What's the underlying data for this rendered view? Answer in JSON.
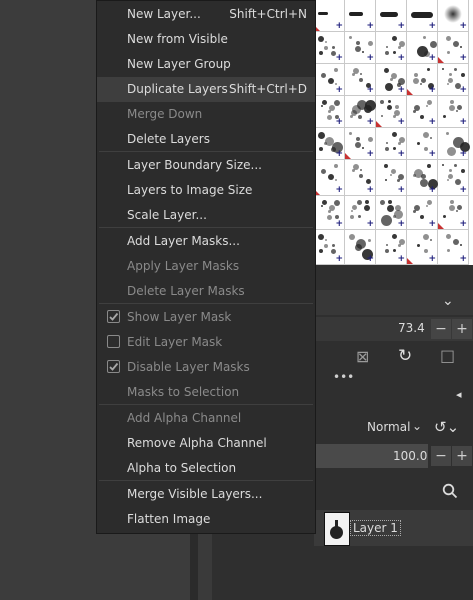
{
  "menu": {
    "items": [
      {
        "label": "New Layer...",
        "accel": "Shift+Ctrl+N",
        "disabled": false
      },
      {
        "label": "New from Visible",
        "accel": "",
        "disabled": false
      },
      {
        "label": "New Layer Group",
        "accel": "",
        "disabled": false
      },
      {
        "label": "Duplicate Layers",
        "accel": "Shift+Ctrl+D",
        "disabled": false,
        "highlighted": true
      },
      {
        "label": "Merge Down",
        "accel": "",
        "disabled": true
      },
      {
        "label": "Delete Layers",
        "accel": "",
        "disabled": false
      },
      {
        "label": "Layer Boundary Size...",
        "accel": "",
        "disabled": false
      },
      {
        "label": "Layers to Image Size",
        "accel": "",
        "disabled": false
      },
      {
        "label": "Scale Layer...",
        "accel": "",
        "disabled": false
      },
      {
        "label": "Add Layer Masks...",
        "accel": "",
        "disabled": false
      },
      {
        "label": "Apply Layer Masks",
        "accel": "",
        "disabled": true
      },
      {
        "label": "Delete Layer Masks",
        "accel": "",
        "disabled": true
      },
      {
        "label": "Show Layer Mask",
        "accel": "",
        "disabled": true,
        "checkbox": true,
        "checked": true
      },
      {
        "label": "Edit Layer Mask",
        "accel": "",
        "disabled": true,
        "checkbox": true,
        "checked": false
      },
      {
        "label": "Disable Layer Masks",
        "accel": "",
        "disabled": true,
        "checkbox": true,
        "checked": true
      },
      {
        "label": "Masks to Selection",
        "accel": "",
        "disabled": true
      },
      {
        "label": "Add Alpha Channel",
        "accel": "",
        "disabled": true
      },
      {
        "label": "Remove Alpha Channel",
        "accel": "",
        "disabled": false
      },
      {
        "label": "Alpha to Selection",
        "accel": "",
        "disabled": false
      },
      {
        "label": "Merge Visible Layers...",
        "accel": "",
        "disabled": false
      },
      {
        "label": "Flatten Image",
        "accel": "",
        "disabled": false
      }
    ]
  },
  "panel": {
    "spacing_value": "73.4",
    "mode_value": "Normal",
    "opacity_value": "100.0",
    "layer_name": "Layer 1"
  },
  "colors": {
    "menu_bg": "#2c2c2c",
    "highlight": "#3e3e3e",
    "disabled_text": "#8a8a8a",
    "text": "#dcdcdc"
  }
}
